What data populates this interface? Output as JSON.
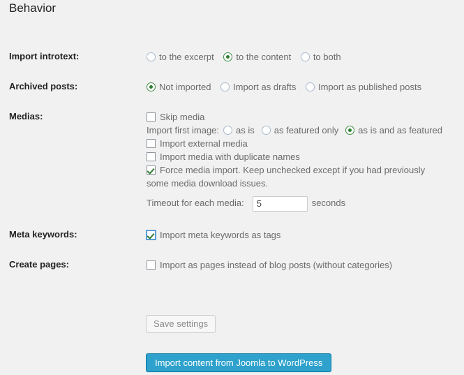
{
  "section": {
    "title": "Behavior"
  },
  "rows": {
    "import_introtext": {
      "label": "Import introtext:",
      "options": [
        {
          "label": "to the excerpt",
          "selected": false
        },
        {
          "label": "to the content",
          "selected": true
        },
        {
          "label": "to both",
          "selected": false
        }
      ]
    },
    "archived_posts": {
      "label": "Archived posts:",
      "options": [
        {
          "label": "Not imported",
          "selected": true
        },
        {
          "label": "Import as drafts",
          "selected": false
        },
        {
          "label": "Import as published posts",
          "selected": false
        }
      ]
    },
    "medias": {
      "label": "Medias:",
      "skip_media": {
        "label": "Skip media",
        "checked": false
      },
      "import_first_image": {
        "prefix": "Import first image:",
        "options": [
          {
            "label": "as is",
            "selected": false
          },
          {
            "label": "as featured only",
            "selected": false
          },
          {
            "label": "as is and as featured",
            "selected": true
          }
        ]
      },
      "import_external_media": {
        "label": "Import external media",
        "checked": false
      },
      "import_duplicate_names": {
        "label": "Import media with duplicate names",
        "checked": false
      },
      "force_media_import": {
        "label": "Force media import. Keep unchecked except if you had previously some media download issues.",
        "checked": true
      },
      "timeout": {
        "prefix": "Timeout for each media:",
        "value": "5",
        "suffix": "seconds"
      }
    },
    "meta_keywords": {
      "label": "Meta keywords:",
      "checkbox": {
        "label": "Import meta keywords as tags",
        "checked": true,
        "focused": true
      }
    },
    "create_pages": {
      "label": "Create pages:",
      "checkbox": {
        "label": "Import as pages instead of blog posts (without categories)",
        "checked": false
      }
    }
  },
  "buttons": {
    "save_settings": "Save settings",
    "import_content": "Import content from Joomla to WordPress"
  },
  "colors": {
    "page_background": "#f1f1f1",
    "primary_button": "#2ea2cc",
    "primary_button_border": "#0074a2",
    "checked_mark": "#2e7d32",
    "focus_ring": "#5b9dd9"
  }
}
